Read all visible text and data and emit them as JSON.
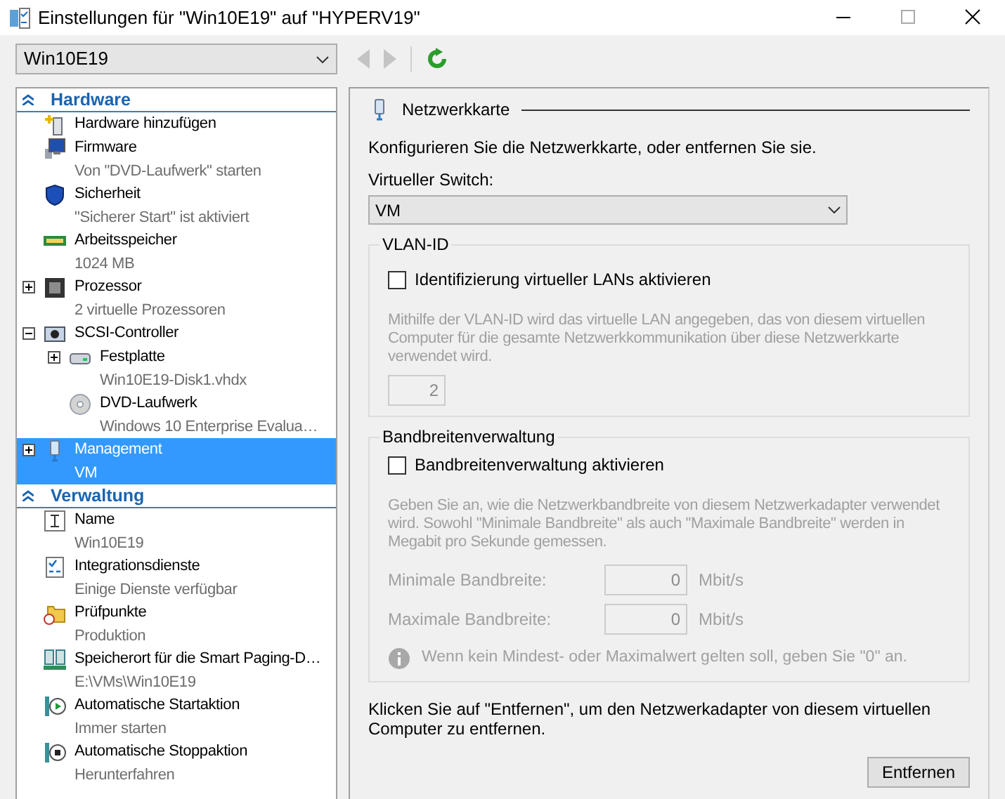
{
  "window": {
    "title": "Einstellungen für \"Win10E19\" auf \"HYPERV19\""
  },
  "vm_selector": {
    "value": "Win10E19"
  },
  "nav_buttons": [
    {
      "kind": "back",
      "disabled": true
    },
    {
      "kind": "forward",
      "disabled": true
    },
    {
      "kind": "refresh",
      "disabled": false
    }
  ],
  "sidebar": {
    "sections": [
      {
        "title": "Hardware",
        "expanded": true,
        "items": [
          {
            "label": "Hardware hinzufügen",
            "kind": "add-hardware",
            "selected": false
          },
          {
            "label": "Firmware",
            "detail": "Von \"DVD-Laufwerk\" starten",
            "kind": "firmware",
            "selected": false
          },
          {
            "label": "Sicherheit",
            "detail": "\"Sicherer Start\" ist aktiviert",
            "kind": "shield",
            "selected": false
          },
          {
            "label": "Arbeitsspeicher",
            "detail": "1024 MB",
            "kind": "memory",
            "selected": false
          },
          {
            "label": "Prozessor",
            "detail": "2 virtuelle Prozessoren",
            "kind": "processor",
            "expanded": false,
            "selected": false
          },
          {
            "label": "SCSI-Controller",
            "kind": "controller",
            "expanded": true,
            "selected": false,
            "children": [
              {
                "label": "Festplatte",
                "detail": "Win10E19-Disk1.vhdx",
                "kind": "disk",
                "expanded": false,
                "selected": false
              },
              {
                "label": "DVD-Laufwerk",
                "detail": "Windows 10 Enterprise Evalua…",
                "kind": "dvd",
                "selected": false
              }
            ]
          },
          {
            "label": "Management",
            "detail": "VM",
            "kind": "network",
            "expanded": false,
            "selected": true
          }
        ]
      },
      {
        "title": "Verwaltung",
        "expanded": true,
        "items": [
          {
            "label": "Name",
            "detail": "Win10E19",
            "kind": "name",
            "selected": false
          },
          {
            "label": "Integrationsdienste",
            "detail": "Einige Dienste verfügbar",
            "kind": "integration",
            "selected": false
          },
          {
            "label": "Prüfpunkte",
            "detail": "Produktion",
            "kind": "checkpoint",
            "selected": false
          },
          {
            "label": "Speicherort für die Smart Paging-D…",
            "detail": "E:\\VMs\\Win10E19",
            "kind": "paging",
            "selected": false
          },
          {
            "label": "Automatische Startaktion",
            "detail": "Immer starten",
            "kind": "start",
            "selected": false
          },
          {
            "label": "Automatische Stoppaktion",
            "detail": "Herunterfahren",
            "kind": "stop",
            "selected": false
          }
        ]
      }
    ]
  },
  "panel": {
    "title": "Netzwerkkarte",
    "intro": "Konfigurieren Sie die Netzwerkkarte, oder entfernen Sie sie.",
    "switch": {
      "label": "Virtueller Switch:",
      "value": "VM"
    },
    "vlan": {
      "title": "VLAN-ID",
      "checkbox": {
        "label": "Identifizierung virtueller LANs aktivieren",
        "checked": false
      },
      "description": "Mithilfe der VLAN-ID wird das virtuelle LAN angegeben, das von diesem virtuellen Computer für die gesamte Netzwerkkommunikation über diese Netzwerkkarte verwendet wird.",
      "field": {
        "value": "2"
      }
    },
    "bandwidth": {
      "title": "Bandbreitenverwaltung",
      "checkbox": {
        "label": "Bandbreitenverwaltung aktivieren",
        "checked": false
      },
      "description": "Geben Sie an, wie die Netzwerkbandbreite von diesem Netzwerkadapter verwendet wird. Sowohl \"Minimale Bandbreite\" als auch \"Maximale Bandbreite\" werden in Megabit pro Sekunde gemessen.",
      "fields": [
        {
          "label": "Minimale Bandbreite:",
          "value": "0",
          "unit": "Mbit/s"
        },
        {
          "label": "Maximale Bandbreite:",
          "value": "0",
          "unit": "Mbit/s"
        }
      ],
      "note": "Wenn kein Mindest- oder Maximalwert gelten soll, geben Sie \"0\" an."
    },
    "remove_text": "Klicken Sie auf \"Entfernen\", um den Netzwerkadapter von diesem virtuellen Computer zu entfernen.",
    "remove_button": "Entfernen"
  }
}
